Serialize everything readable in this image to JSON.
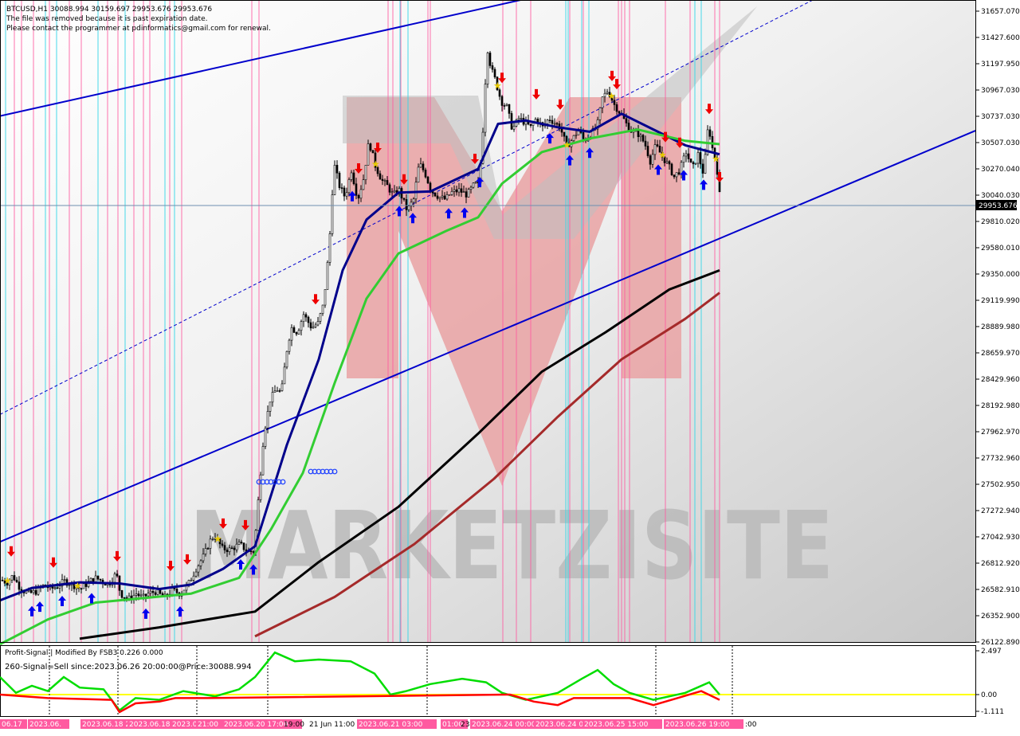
{
  "header": {
    "symbol_line": "BTCUSD,H1  30088.994 30159.697 29953.676 29953.676",
    "notice_1": "The file was removed because it is past expiration date.",
    "notice_2": "Please contact the programmer at pdinformatics@gmail.com for renewal."
  },
  "watermark": {
    "text": "MARKETZISITE"
  },
  "price_axis": {
    "ticks": [
      "31657.070",
      "31427.600",
      "31197.950",
      "30967.030",
      "30737.030",
      "30507.030",
      "30270.040",
      "30040.030",
      "29810.020",
      "29580.010",
      "29350.000",
      "29119.990",
      "28889.980",
      "28659.970",
      "28429.960",
      "28192.980",
      "27962.970",
      "27732.960",
      "27502.950",
      "27272.940",
      "27042.930",
      "26812.920",
      "26582.910",
      "26352.900",
      "26122.890"
    ],
    "current_price": "29953.676",
    "current_price_color": "#000000"
  },
  "indicator": {
    "title": "Profit-Signal | Modified By FSB3  0.226 0.000",
    "signal_line": "260-Signal=Sell since:2023.06.26 20:00:00@Price:30088.994",
    "ticks": [
      "2.497",
      "0.00",
      "-1.111"
    ]
  },
  "time_axis": {
    "labels": [
      {
        "text": "06.17",
        "pink": true
      },
      {
        "text": "2023.06.",
        "pink": true
      },
      {
        "text": "2023.06.18 20:00",
        "pink": true
      },
      {
        "text": "2023.06.18 21:00",
        "pink": true
      },
      {
        "text": "2023.06.19 13:00",
        "pink": true
      },
      {
        "text": "21:00",
        "pink": true
      },
      {
        "text": "2023.06.20 17:00",
        "pink": true
      },
      {
        "text": "19:00",
        "pink": false
      },
      {
        "text": "21 Jun 11:00",
        "pink": false
      },
      {
        "text": "2023.06.21 03:00",
        "pink": true
      },
      {
        "text": "01:00",
        "pink": true
      },
      {
        "text": "23",
        "pink": false
      },
      {
        "text": "2023.06.24 00:00",
        "pink": true
      },
      {
        "text": "2023.06.24 08:00",
        "pink": true
      },
      {
        "text": "2023.06.25 15:00",
        "pink": true
      },
      {
        "text": "2023.06.26 19:00",
        "pink": true
      },
      {
        "text": ":00",
        "pink": false
      }
    ]
  },
  "chart_data": {
    "type": "candlestick",
    "symbol": "BTCUSD",
    "timeframe": "H1",
    "ohlc_last": {
      "open": 30088.994,
      "high": 30159.697,
      "low": 29953.676,
      "close": 29953.676
    },
    "y_range": [
      26050,
      31750
    ],
    "price_path": [
      [
        0,
        26600
      ],
      [
        8,
        26580
      ],
      [
        15,
        26640
      ],
      [
        25,
        26520
      ],
      [
        35,
        26480
      ],
      [
        45,
        26500
      ],
      [
        55,
        26560
      ],
      [
        62,
        26520
      ],
      [
        70,
        26540
      ],
      [
        80,
        26590
      ],
      [
        90,
        26560
      ],
      [
        100,
        26520
      ],
      [
        110,
        26580
      ],
      [
        118,
        26620
      ],
      [
        125,
        26600
      ],
      [
        135,
        26560
      ],
      [
        145,
        26660
      ],
      [
        150,
        26480
      ],
      [
        160,
        26430
      ],
      [
        170,
        26480
      ],
      [
        178,
        26440
      ],
      [
        185,
        26480
      ],
      [
        195,
        26500
      ],
      [
        205,
        26440
      ],
      [
        215,
        26510
      ],
      [
        225,
        26480
      ],
      [
        235,
        26560
      ],
      [
        245,
        26700
      ],
      [
        255,
        26820
      ],
      [
        262,
        26940
      ],
      [
        268,
        27000
      ],
      [
        278,
        26880
      ],
      [
        288,
        26870
      ],
      [
        300,
        26920
      ],
      [
        310,
        26850
      ],
      [
        318,
        26860
      ],
      [
        325,
        27480
      ],
      [
        330,
        27900
      ],
      [
        338,
        28200
      ],
      [
        346,
        28300
      ],
      [
        352,
        28260
      ],
      [
        360,
        28700
      ],
      [
        365,
        28840
      ],
      [
        372,
        28800
      ],
      [
        380,
        28960
      ],
      [
        390,
        28840
      ],
      [
        398,
        28880
      ],
      [
        405,
        29050
      ],
      [
        412,
        29550
      ],
      [
        418,
        30300
      ],
      [
        425,
        30100
      ],
      [
        432,
        30000
      ],
      [
        440,
        30240
      ],
      [
        448,
        29980
      ],
      [
        455,
        30160
      ],
      [
        462,
        30500
      ],
      [
        470,
        30280
      ],
      [
        478,
        30150
      ],
      [
        485,
        30100
      ],
      [
        492,
        30020
      ],
      [
        500,
        30060
      ],
      [
        510,
        29880
      ],
      [
        518,
        29980
      ],
      [
        525,
        30300
      ],
      [
        532,
        30220
      ],
      [
        540,
        30060
      ],
      [
        550,
        30000
      ],
      [
        558,
        29980
      ],
      [
        565,
        30040
      ],
      [
        575,
        30060
      ],
      [
        585,
        30020
      ],
      [
        595,
        30120
      ],
      [
        600,
        30100
      ],
      [
        606,
        30700
      ],
      [
        610,
        31350
      ],
      [
        615,
        31150
      ],
      [
        620,
        31050
      ],
      [
        628,
        30850
      ],
      [
        635,
        30800
      ],
      [
        642,
        30600
      ],
      [
        650,
        30700
      ],
      [
        658,
        30660
      ],
      [
        665,
        30620
      ],
      [
        672,
        30700
      ],
      [
        680,
        30620
      ],
      [
        688,
        30700
      ],
      [
        695,
        30660
      ],
      [
        702,
        30620
      ],
      [
        710,
        30450
      ],
      [
        718,
        30520
      ],
      [
        725,
        30600
      ],
      [
        732,
        30500
      ],
      [
        740,
        30560
      ],
      [
        748,
        30620
      ],
      [
        755,
        30880
      ],
      [
        762,
        30950
      ],
      [
        770,
        30820
      ],
      [
        778,
        30740
      ],
      [
        785,
        30650
      ],
      [
        792,
        30580
      ],
      [
        800,
        30560
      ],
      [
        808,
        30480
      ],
      [
        815,
        30320
      ],
      [
        822,
        30460
      ],
      [
        830,
        30360
      ],
      [
        838,
        30280
      ],
      [
        845,
        30180
      ],
      [
        852,
        30240
      ],
      [
        860,
        30400
      ],
      [
        868,
        30250
      ],
      [
        875,
        30380
      ],
      [
        882,
        30200
      ],
      [
        888,
        30660
      ],
      [
        892,
        30460
      ],
      [
        898,
        30300
      ],
      [
        903,
        29953.676
      ]
    ],
    "moving_averages": [
      {
        "color": "#00008b",
        "path": [
          [
            0,
            26420
          ],
          [
            40,
            26530
          ],
          [
            100,
            26580
          ],
          [
            150,
            26570
          ],
          [
            200,
            26520
          ],
          [
            240,
            26560
          ],
          [
            280,
            26700
          ],
          [
            320,
            26900
          ],
          [
            360,
            27800
          ],
          [
            400,
            28560
          ],
          [
            430,
            29350
          ],
          [
            460,
            29800
          ],
          [
            500,
            30040
          ],
          [
            540,
            30050
          ],
          [
            600,
            30250
          ],
          [
            625,
            30650
          ],
          [
            660,
            30680
          ],
          [
            700,
            30620
          ],
          [
            740,
            30580
          ],
          [
            780,
            30740
          ],
          [
            820,
            30600
          ],
          [
            860,
            30460
          ],
          [
            903,
            30380
          ]
        ]
      },
      {
        "color": "#32cd32",
        "path": [
          [
            0,
            26030
          ],
          [
            60,
            26250
          ],
          [
            120,
            26400
          ],
          [
            180,
            26440
          ],
          [
            240,
            26480
          ],
          [
            300,
            26620
          ],
          [
            340,
            27050
          ],
          [
            380,
            27550
          ],
          [
            420,
            28350
          ],
          [
            460,
            29100
          ],
          [
            500,
            29500
          ],
          [
            560,
            29700
          ],
          [
            600,
            29820
          ],
          [
            630,
            30120
          ],
          [
            680,
            30400
          ],
          [
            740,
            30520
          ],
          [
            800,
            30600
          ],
          [
            860,
            30500
          ],
          [
            903,
            30470
          ]
        ]
      },
      {
        "color": "#000000",
        "path": [
          [
            100,
            26080
          ],
          [
            200,
            26180
          ],
          [
            320,
            26320
          ],
          [
            400,
            26760
          ],
          [
            500,
            27250
          ],
          [
            600,
            27900
          ],
          [
            680,
            28450
          ],
          [
            760,
            28800
          ],
          [
            840,
            29180
          ],
          [
            903,
            29350
          ]
        ]
      },
      {
        "color": "#a52a2a",
        "path": [
          [
            320,
            26100
          ],
          [
            420,
            26450
          ],
          [
            520,
            26920
          ],
          [
            620,
            27500
          ],
          [
            700,
            28050
          ],
          [
            780,
            28560
          ],
          [
            860,
            28920
          ],
          [
            903,
            29150
          ]
        ]
      }
    ],
    "channel_lines": [
      {
        "style": "solid",
        "color": "#0000cc",
        "from": [
          0,
          30720
        ],
        "to": [
          685,
          31800
        ]
      },
      {
        "style": "solid",
        "color": "#0000cc",
        "from": [
          0,
          26940
        ],
        "to": [
          1224,
          30590
        ]
      },
      {
        "style": "dashed",
        "color": "#0000cc",
        "from": [
          0,
          28070
        ],
        "to": [
          1020,
          31750
        ]
      }
    ],
    "indicator_series": [
      {
        "name": "green",
        "color": "#00dd00",
        "path": [
          [
            0,
            1.0
          ],
          [
            20,
            0.1
          ],
          [
            40,
            0.5
          ],
          [
            60,
            0.2
          ],
          [
            80,
            1.0
          ],
          [
            100,
            0.4
          ],
          [
            130,
            0.3
          ],
          [
            150,
            -0.9
          ],
          [
            170,
            -0.2
          ],
          [
            200,
            -0.3
          ],
          [
            230,
            0.2
          ],
          [
            270,
            -0.1
          ],
          [
            300,
            0.3
          ],
          [
            320,
            1.0
          ],
          [
            345,
            2.4
          ],
          [
            370,
            1.9
          ],
          [
            400,
            2.0
          ],
          [
            440,
            1.9
          ],
          [
            470,
            1.2
          ],
          [
            490,
            0.0
          ],
          [
            510,
            0.2
          ],
          [
            540,
            0.6
          ],
          [
            580,
            0.9
          ],
          [
            610,
            0.7
          ],
          [
            630,
            0.1
          ],
          [
            660,
            -0.3
          ],
          [
            700,
            0.1
          ],
          [
            730,
            0.9
          ],
          [
            750,
            1.4
          ],
          [
            770,
            0.6
          ],
          [
            790,
            0.1
          ],
          [
            820,
            -0.3
          ],
          [
            860,
            0.1
          ],
          [
            890,
            0.7
          ],
          [
            903,
            0.0
          ]
        ]
      },
      {
        "name": "red",
        "color": "#ff0000",
        "path": [
          [
            0,
            0.0
          ],
          [
            60,
            -0.2
          ],
          [
            140,
            -0.3
          ],
          [
            150,
            -1.0
          ],
          [
            170,
            -0.5
          ],
          [
            200,
            -0.4
          ],
          [
            220,
            -0.2
          ],
          [
            260,
            -0.2
          ],
          [
            640,
            0.0
          ],
          [
            670,
            -0.4
          ],
          [
            700,
            -0.6
          ],
          [
            720,
            -0.2
          ],
          [
            790,
            -0.2
          ],
          [
            820,
            -0.6
          ],
          [
            850,
            -0.2
          ],
          [
            880,
            0.2
          ],
          [
            903,
            -0.3
          ]
        ]
      }
    ]
  }
}
